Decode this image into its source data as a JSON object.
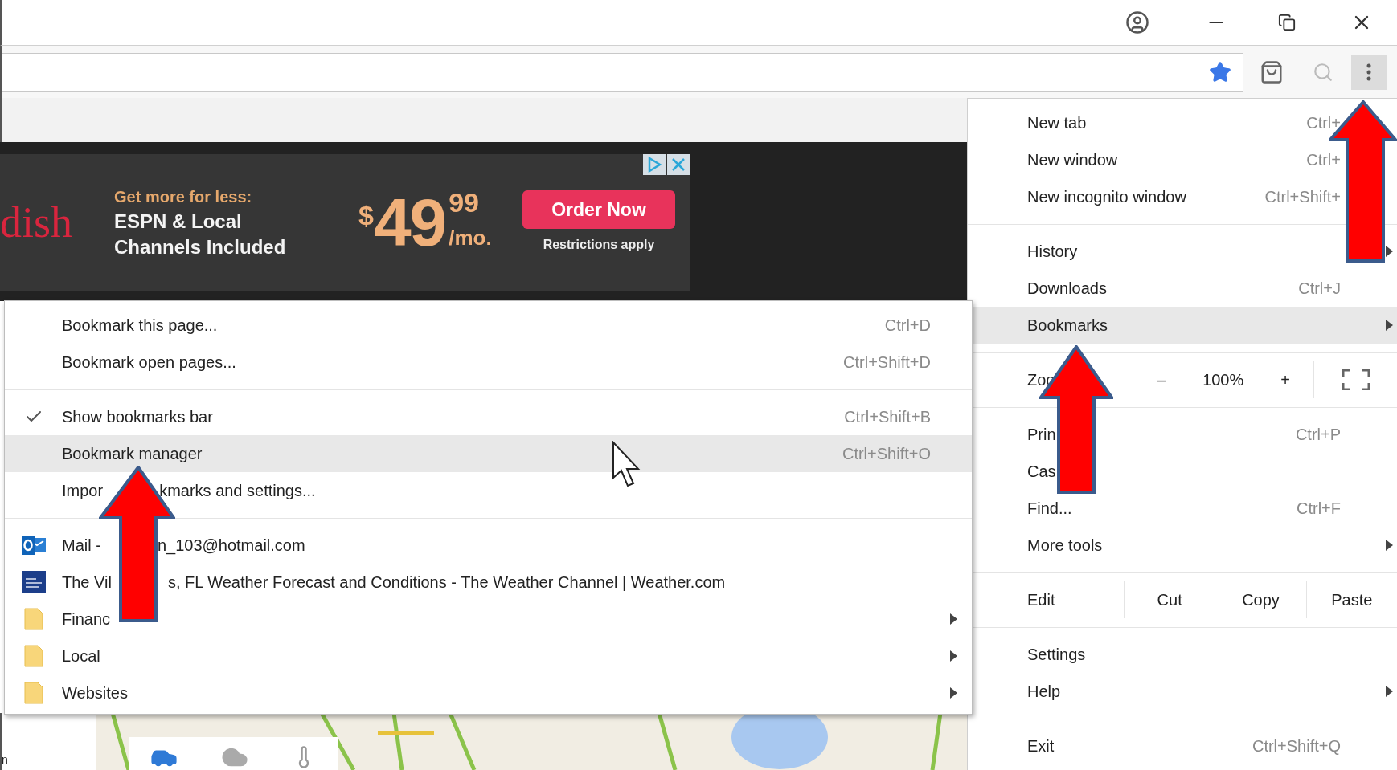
{
  "toolbar": {
    "page_bookmarked": true
  },
  "ad": {
    "brand": "dish",
    "tagline": "Get more for less:",
    "lines": [
      "ESPN & Local",
      "Channels Included"
    ],
    "currency": "$",
    "price": "49",
    "cents": "99",
    "period": "/mo.",
    "button": "Order Now",
    "note": "Restrictions apply"
  },
  "main_menu": {
    "items": [
      {
        "kind": "command",
        "label": "New tab",
        "shortcut": "Ctrl+",
        "has_submenu": false,
        "selected": false
      },
      {
        "kind": "command",
        "label": "New window",
        "shortcut": "Ctrl+",
        "has_submenu": false,
        "selected": false
      },
      {
        "kind": "command",
        "label": "New incognito window",
        "shortcut": "Ctrl+Shift+",
        "has_submenu": false,
        "selected": false
      },
      {
        "kind": "separator"
      },
      {
        "kind": "command",
        "label": "History",
        "has_submenu": true,
        "selected": false
      },
      {
        "kind": "command",
        "label": "Downloads",
        "shortcut": "Ctrl+J",
        "has_submenu": false,
        "selected": false
      },
      {
        "kind": "command",
        "label": "Bookmarks",
        "has_submenu": true,
        "selected": true
      },
      {
        "kind": "separator"
      },
      {
        "kind": "zoom",
        "label": "Zoo",
        "minus": "–",
        "value": "100%",
        "plus": "+"
      },
      {
        "kind": "separator"
      },
      {
        "kind": "command",
        "label": "Prin",
        "shortcut": "Ctrl+P",
        "has_submenu": false,
        "selected": false
      },
      {
        "kind": "command",
        "label": "Cas",
        "has_submenu": false,
        "selected": false
      },
      {
        "kind": "command",
        "label": "Find...",
        "shortcut": "Ctrl+F",
        "has_submenu": false,
        "selected": false
      },
      {
        "kind": "command",
        "label": "More tools",
        "has_submenu": true,
        "selected": false
      },
      {
        "kind": "separator"
      },
      {
        "kind": "edit",
        "label": "Edit",
        "actions": [
          "Cut",
          "Copy",
          "Paste"
        ]
      },
      {
        "kind": "separator"
      },
      {
        "kind": "command",
        "label": "Settings",
        "has_submenu": false,
        "selected": false
      },
      {
        "kind": "command",
        "label": "Help",
        "has_submenu": true,
        "selected": false
      },
      {
        "kind": "separator"
      },
      {
        "kind": "command",
        "label": "Exit",
        "shortcut": "Ctrl+Shift+Q",
        "has_submenu": false,
        "selected": false
      }
    ]
  },
  "bookmarks_menu": {
    "items": [
      {
        "kind": "command",
        "label": "Bookmark this page...",
        "shortcut": "Ctrl+D",
        "checked": false,
        "selected": false
      },
      {
        "kind": "command",
        "label": "Bookmark open pages...",
        "shortcut": "Ctrl+Shift+D",
        "checked": false,
        "selected": false
      },
      {
        "kind": "separator"
      },
      {
        "kind": "command",
        "label": "Show bookmarks bar",
        "shortcut": "Ctrl+Shift+B",
        "checked": true,
        "selected": false
      },
      {
        "kind": "command",
        "label": "Bookmark manager",
        "shortcut": "Ctrl+Shift+O",
        "checked": false,
        "selected": true
      },
      {
        "kind": "command",
        "label": "Impor",
        "label_tail": "kmarks and settings...",
        "checked": false,
        "selected": false
      },
      {
        "kind": "separator"
      },
      {
        "kind": "mail",
        "label": "Mail -",
        "label_tail": "n_103@hotmail.com",
        "selected": false
      },
      {
        "kind": "site",
        "label": "The Vil",
        "label_tail": "s, FL Weather Forecast and Conditions - The Weather Channel | Weather.com",
        "selected": false
      },
      {
        "kind": "folder",
        "label": "Financ",
        "selected": false
      },
      {
        "kind": "folder",
        "label": "Local",
        "selected": false
      },
      {
        "kind": "folder",
        "label": "Websites",
        "selected": false
      }
    ]
  },
  "left_edge_text": "n"
}
